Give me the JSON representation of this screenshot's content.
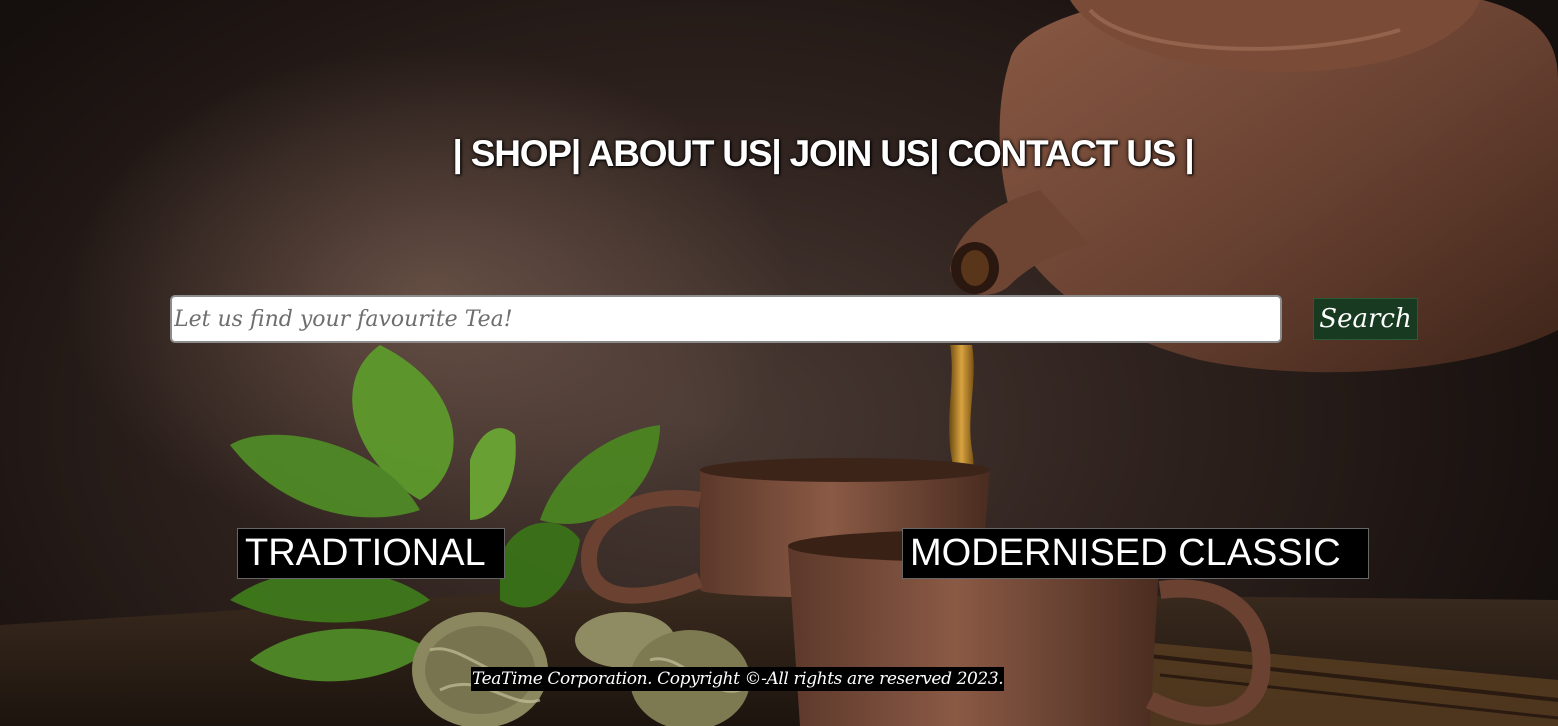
{
  "nav": {
    "items": [
      {
        "label": "SHOP"
      },
      {
        "label": "ABOUT US"
      },
      {
        "label": "JOIN US"
      },
      {
        "label": "CONTACT US"
      }
    ],
    "separator": "|"
  },
  "search": {
    "placeholder": "Let us find your favourite Tea!",
    "value": "",
    "button_label": "Search"
  },
  "categories": {
    "traditional": "TRADTIONAL",
    "modern": "MODERNISED CLASSIC"
  },
  "footer": {
    "text": "TeaTime Corporation. Copyright ©-All rights are reserved 2023."
  },
  "colors": {
    "search_button_bg": "#173a20",
    "nav_text": "#ffffff",
    "label_bg": "#000000"
  }
}
